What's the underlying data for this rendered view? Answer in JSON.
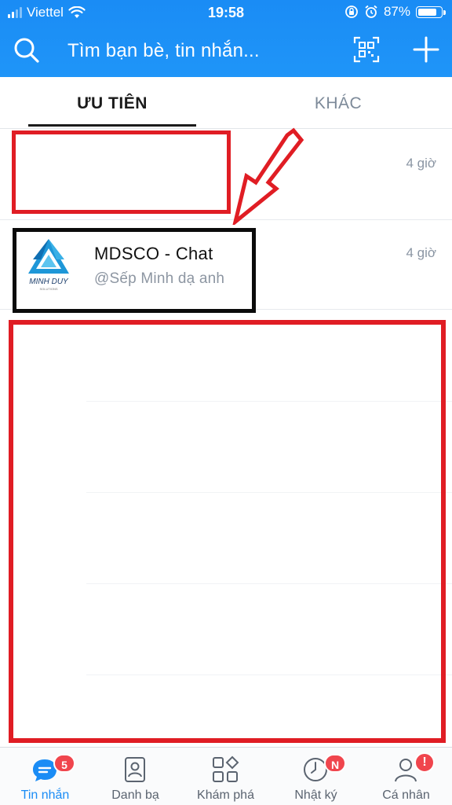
{
  "status_bar": {
    "carrier": "Viettel",
    "time": "19:58",
    "battery_percent": "87%",
    "battery_level": 0.87,
    "icons": [
      "signal-icon",
      "wifi-icon",
      "rotation-lock-icon",
      "alarm-icon",
      "battery-icon"
    ]
  },
  "search": {
    "placeholder": "Tìm bạn bè, tin nhắn...",
    "icons": [
      "search-icon",
      "qr-code-icon",
      "plus-icon"
    ]
  },
  "tabs": [
    {
      "label": "ƯU TIÊN",
      "active": true
    },
    {
      "label": "KHÁC",
      "active": false
    }
  ],
  "conversations": [
    {
      "name": "",
      "preview": "",
      "time": "4 giờ"
    },
    {
      "name": "MDSCO - Chat",
      "preview": "@Sếp Minh dạ anh",
      "time": "4 giờ",
      "avatar_text": "MINH DUY",
      "avatar_subtext": "SOLUTIONS"
    }
  ],
  "bottom_nav": [
    {
      "label": "Tin nhắn",
      "icon": "chat-icon",
      "active": true,
      "badge": "5"
    },
    {
      "label": "Danh bạ",
      "icon": "contacts-icon",
      "active": false,
      "badge": ""
    },
    {
      "label": "Khám phá",
      "icon": "discover-icon",
      "active": false,
      "badge": ""
    },
    {
      "label": "Nhật ký",
      "icon": "clock-icon",
      "active": false,
      "badge": "N"
    },
    {
      "label": "Cá nhân",
      "icon": "profile-icon",
      "active": false,
      "badge": "!"
    }
  ],
  "colors": {
    "header_blue": "#1a8cf5",
    "annotation_red": "#e01d24",
    "annotation_black": "#0b0b0b",
    "badge_red": "#f0454d"
  }
}
